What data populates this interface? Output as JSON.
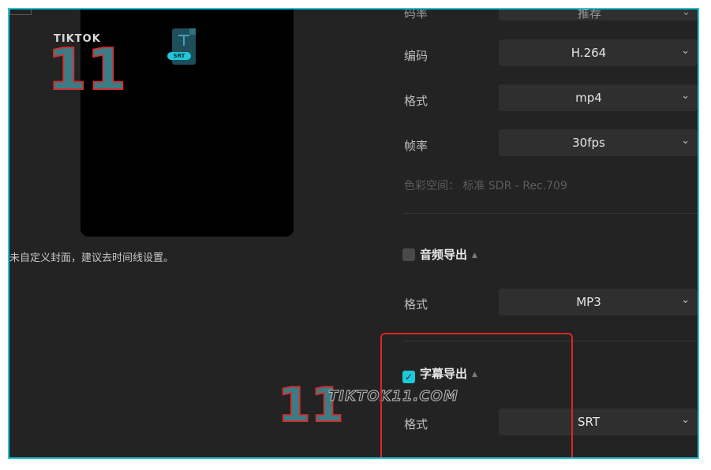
{
  "preview": {
    "file_tag": "SRT",
    "hint": "未自定义封面，建议去时间线设置。"
  },
  "watermark": {
    "top_text": "TIKTOK",
    "top_number": "11",
    "center_text": "TIKTOK11.COM",
    "center_number": "11"
  },
  "video_settings": {
    "partial_label": "码率",
    "partial_value": "推荐",
    "rows": [
      {
        "label": "编码",
        "value": "H.264"
      },
      {
        "label": "格式",
        "value": "mp4"
      },
      {
        "label": "帧率",
        "value": "30fps"
      }
    ],
    "color_space": "色彩空间：  标准 SDR - Rec.709"
  },
  "audio_export": {
    "title": "音频导出",
    "checked": false,
    "format_label": "格式",
    "format_value": "MP3"
  },
  "subtitle_export": {
    "title": "字幕导出",
    "checked": true,
    "format_label": "格式",
    "format_value": "SRT"
  },
  "colors": {
    "accent": "#1fc8d8",
    "highlight_box": "#e02525",
    "panel_bg": "#232323"
  },
  "icons": {
    "dropdown": "chevron-down-icon",
    "collapse": "caret-up-icon",
    "check": "checkmark-icon"
  }
}
